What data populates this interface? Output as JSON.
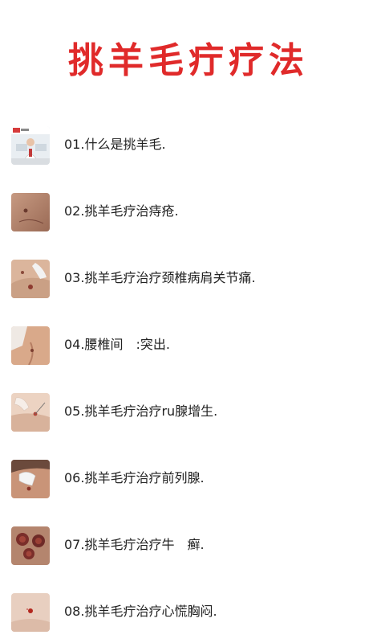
{
  "page": {
    "title": "挑羊毛疔疗法",
    "accent_color": "#e02a2a"
  },
  "items": [
    {
      "label": "01.什么是挑羊毛.",
      "thumb_icon": "video-thumbnail-doctor"
    },
    {
      "label": "02.挑羊毛疗治痔疮.",
      "thumb_icon": "skin-thumbnail"
    },
    {
      "label": "03.挑羊毛疗治疗颈椎病肩关节痛.",
      "thumb_icon": "neck-treatment-thumbnail"
    },
    {
      "label": "04.腰椎间　:突出.",
      "thumb_icon": "back-treatment-thumbnail"
    },
    {
      "label": "05.挑羊毛疔治疗ru腺增生.",
      "thumb_icon": "hand-treatment-thumbnail"
    },
    {
      "label": "06.挑羊毛疔治疗前列腺.",
      "thumb_icon": "glove-treatment-thumbnail"
    },
    {
      "label": "07.挑羊毛疔治疗牛　癣.",
      "thumb_icon": "cupping-thumbnail"
    },
    {
      "label": "08.挑羊毛疔治疗心慌胸闷.",
      "thumb_icon": "skin-spot-thumbnail"
    }
  ]
}
